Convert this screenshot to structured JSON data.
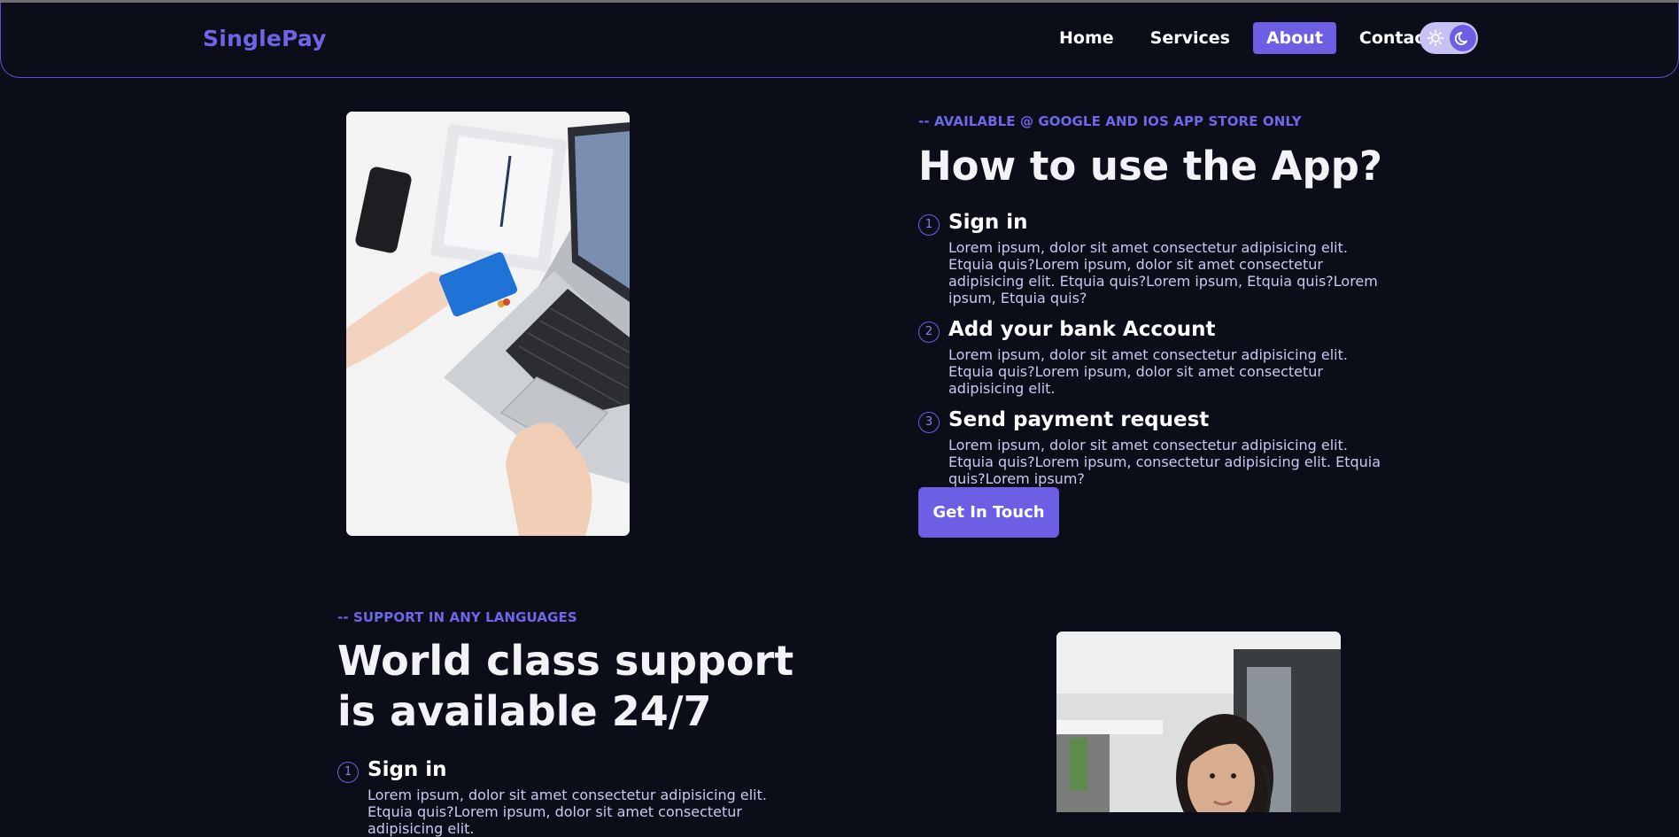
{
  "brand": "SinglePay",
  "nav": {
    "items": [
      {
        "label": "Home",
        "active": false
      },
      {
        "label": "Services",
        "active": false
      },
      {
        "label": "About",
        "active": true
      },
      {
        "label": "Contact",
        "active": false
      }
    ],
    "theme_toggle": {
      "mode": "dark",
      "icons": [
        "sun-icon",
        "moon-icon"
      ]
    }
  },
  "section1": {
    "eyebrow": "-- AVAILABLE @ GOOGLE AND IOS APP STORE ONLY",
    "heading": "How to use the App?",
    "steps": [
      {
        "num": "1",
        "title": "Sign in",
        "body": "Lorem ipsum, dolor sit amet consectetur adipisicing elit. Etquia quis?Lorem ipsum, dolor sit amet consectetur adipisicing elit. Etquia quis?Lorem ipsum, Etquia quis?Lorem ipsum, Etquia quis?"
      },
      {
        "num": "2",
        "title": "Add your bank Account",
        "body": "Lorem ipsum, dolor sit amet consectetur adipisicing elit. Etquia quis?Lorem ipsum, dolor sit amet consectetur adipisicing elit."
      },
      {
        "num": "3",
        "title": "Send payment request",
        "body": "Lorem ipsum, dolor sit amet consectetur adipisicing elit. Etquia quis?Lorem ipsum, consectetur adipisicing elit. Etquia quis?Lorem ipsum?"
      }
    ],
    "cta": "Get In Touch"
  },
  "section2": {
    "eyebrow": "-- SUPPORT IN ANY LANGUAGES",
    "heading": "World class support is available 24/7",
    "steps": [
      {
        "num": "1",
        "title": "Sign in",
        "body": "Lorem ipsum, dolor sit amet consectetur adipisicing elit. Etquia quis?Lorem ipsum, dolor sit amet consectetur adipisicing elit."
      }
    ]
  },
  "colors": {
    "accent": "#6c5fe4",
    "background": "#0b0e18",
    "body_text": "#c9c8f0"
  }
}
